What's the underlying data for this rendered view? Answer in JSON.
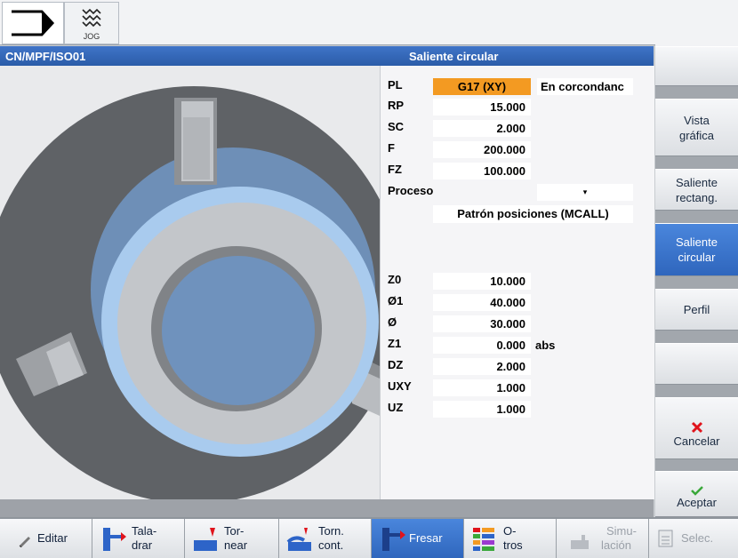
{
  "topbar": {
    "mode_label": "JOG"
  },
  "header": {
    "path": "CN/MPF/ISO01",
    "title": "Saliente circular"
  },
  "params_top": [
    {
      "label": "PL",
      "value": "G17 (XY)",
      "extra": "En corcondanc"
    },
    {
      "label": "RP",
      "value": "15.000"
    },
    {
      "label": "SC",
      "value": "2.000"
    },
    {
      "label": "F",
      "value": "200.000"
    },
    {
      "label": "FZ",
      "value": "100.000"
    }
  ],
  "proceso": {
    "label": "Proceso",
    "dropdown_icon": "▾",
    "value": "Patrón posiciones (MCALL)"
  },
  "params_bottom": [
    {
      "label": "Z0",
      "value": "10.000",
      "unit": ""
    },
    {
      "label": "Ø1",
      "value": "40.000",
      "unit": ""
    },
    {
      "label": "Ø",
      "value": "30.000",
      "unit": ""
    },
    {
      "label": "Z1",
      "value": "0.000",
      "unit": "abs"
    },
    {
      "label": "DZ",
      "value": "2.000",
      "unit": ""
    },
    {
      "label": "UXY",
      "value": "1.000",
      "unit": ""
    },
    {
      "label": "UZ",
      "value": "1.000",
      "unit": ""
    }
  ],
  "softkeys": {
    "vista": "Vista\ngráfica",
    "rect": "Saliente\nrectang.",
    "circ": "Saliente\ncircular",
    "perfil": "Perfil",
    "cancel": "Cancelar",
    "accept": "Aceptar"
  },
  "bottom": {
    "editar": "Editar",
    "taladrar_1": "Tala-",
    "taladrar_2": "drar",
    "tornear_1": "Tor-",
    "tornear_2": "near",
    "torn_cont_1": "Torn.",
    "torn_cont_2": "cont.",
    "fresar": "Fresar",
    "otros_1": "O-",
    "otros_2": "tros",
    "simulacion_1": "Simu-",
    "simulacion_2": "lación",
    "selec": "Selec."
  },
  "colors": {
    "header_blue": "#2f63b4",
    "active_orange": "#f39a22",
    "softkey_active": "#3a74cc"
  }
}
